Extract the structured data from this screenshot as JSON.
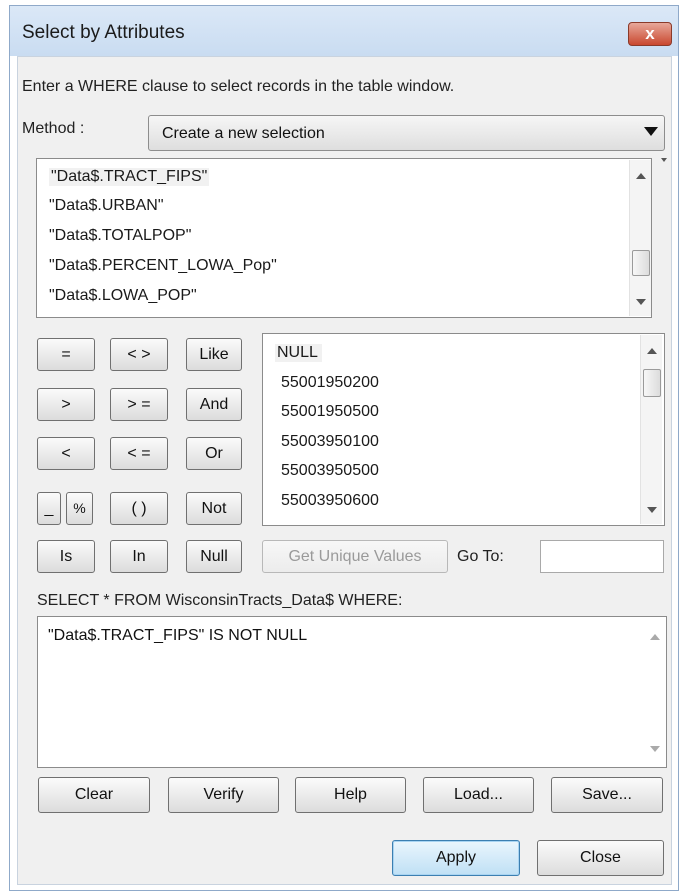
{
  "window": {
    "title": "Select by Attributes",
    "close_label": "x"
  },
  "instruction": "Enter a WHERE clause to select records in the table window.",
  "method": {
    "label": "Method :",
    "value": "Create a new selection"
  },
  "fields": [
    "\"Data$.TRACT_FIPS\"",
    "\"Data$.URBAN\"",
    "\"Data$.TOTALPOP\"",
    "\"Data$.PERCENT_LOWA_Pop\"",
    "\"Data$.LOWA_POP\""
  ],
  "operators": {
    "eq": "=",
    "neq": "< >",
    "like": "Like",
    "gt": ">",
    "gte": "> =",
    "and": "And",
    "lt": "<",
    "lte": "< =",
    "or": "Or",
    "underscore": "_",
    "percent": "%",
    "parens": "( )",
    "not": "Not",
    "is": "Is",
    "in": "In",
    "null": "Null"
  },
  "values": [
    "NULL",
    "55001950200",
    "55001950500",
    "55003950100",
    "55003950500",
    "55003950600"
  ],
  "unique_values_button": "Get Unique Values",
  "goto_label": "Go To:",
  "goto_value": "",
  "sql_prefix": "SELECT * FROM WisconsinTracts_Data$ WHERE:",
  "where_clause": "\"Data$.TRACT_FIPS\" IS NOT NULL",
  "buttons": {
    "clear": "Clear",
    "verify": "Verify",
    "help": "Help",
    "load": "Load...",
    "save": "Save...",
    "apply": "Apply",
    "close": "Close"
  }
}
